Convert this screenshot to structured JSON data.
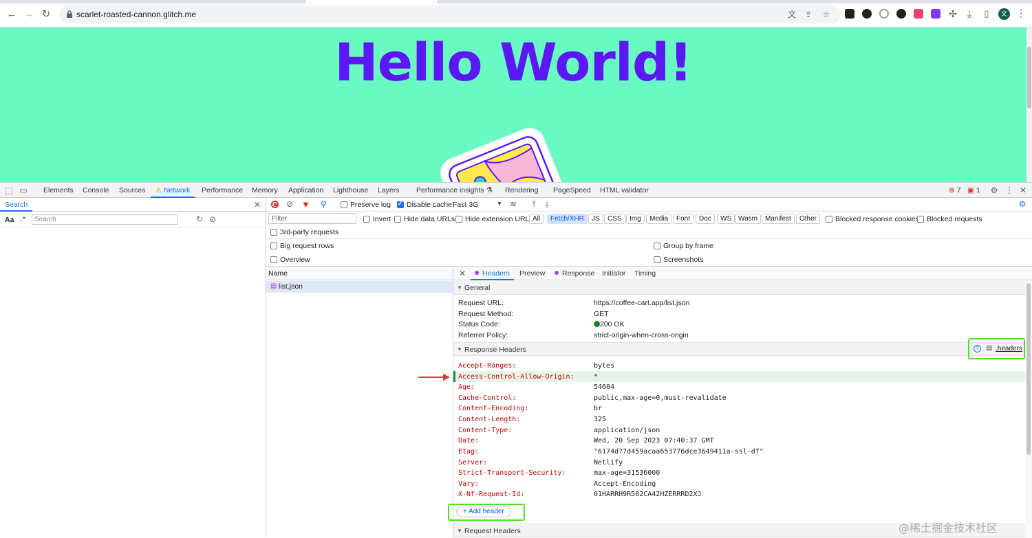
{
  "browser": {
    "url": "scarlet-roasted-cannon.glitch.me",
    "avatar_letter": "文"
  },
  "page": {
    "heading": "Hello World!"
  },
  "devtools": {
    "tabs": [
      "Elements",
      "Console",
      "Sources",
      "Network",
      "Performance",
      "Memory",
      "Application",
      "Lighthouse",
      "Layers",
      "Performance insights",
      "Rendering",
      "PageSpeed",
      "HTML validator"
    ],
    "active_tab": "Network",
    "error_count": "7",
    "issue_count": "1"
  },
  "search": {
    "tab_label": "Search",
    "case_label": "Aa",
    "regex_label": ".*",
    "placeholder": "Search"
  },
  "network": {
    "preserve_log": "Preserve log",
    "disable_cache": "Disable cache",
    "throttle": "Fast 3G",
    "filter_placeholder": "Filter",
    "invert": "Invert",
    "hide_data_urls": "Hide data URLs",
    "hide_extension_urls": "Hide extension URLs",
    "types": [
      "All",
      "Fetch/XHR",
      "JS",
      "CSS",
      "Img",
      "Media",
      "Font",
      "Doc",
      "WS",
      "Wasm",
      "Manifest",
      "Other"
    ],
    "active_type": "Fetch/XHR",
    "blocked_cookies": "Blocked response cookies",
    "blocked_requests": "Blocked requests",
    "third_party": "3rd-party requests",
    "big_rows": "Big request rows",
    "group_by_frame": "Group by frame",
    "overview": "Overview",
    "screenshots": "Screenshots",
    "name_col": "Name",
    "request_name": "list.json"
  },
  "details": {
    "tabs": [
      "Headers",
      "Preview",
      "Response",
      "Initiator",
      "Timing"
    ],
    "general_title": "General",
    "general": [
      {
        "k": "Request URL:",
        "v": "https://coffee-cart.app/list.json"
      },
      {
        "k": "Request Method:",
        "v": "GET"
      },
      {
        "k": "Status Code:",
        "v": "200 OK"
      },
      {
        "k": "Referrer Policy:",
        "v": "strict-origin-when-cross-origin"
      }
    ],
    "response_title": "Response Headers",
    "headers_link": ".headers",
    "response_headers": [
      {
        "k": "Accept-Ranges:",
        "v": "bytes"
      },
      {
        "k": "Access-Control-Allow-Origin:",
        "v": "*"
      },
      {
        "k": "Age:",
        "v": "54604"
      },
      {
        "k": "Cache-Control:",
        "v": "public,max-age=0,must-revalidate"
      },
      {
        "k": "Content-Encoding:",
        "v": "br"
      },
      {
        "k": "Content-Length:",
        "v": "325"
      },
      {
        "k": "Content-Type:",
        "v": "application/json"
      },
      {
        "k": "Date:",
        "v": "Wed, 20 Sep 2023 07:40:37 GMT"
      },
      {
        "k": "Etag:",
        "v": "\"6174d77d459acaa653776dce3649411a-ssl-df\""
      },
      {
        "k": "Server:",
        "v": "Netlify"
      },
      {
        "k": "Strict-Transport-Security:",
        "v": "max-age=31536000"
      },
      {
        "k": "Vary:",
        "v": "Accept-Encoding"
      },
      {
        "k": "X-Nf-Request-Id:",
        "v": "01HARRH9R502CA42HZERRRD2XJ"
      }
    ],
    "add_header": "+ Add header",
    "request_title": "Request Headers"
  },
  "watermark": "@稀土掘金技术社区",
  "colors": {
    "page_bg": "#69fac3",
    "heading": "#5a18f5",
    "accent": "#1a73e8",
    "highlight": "#4be32a"
  }
}
